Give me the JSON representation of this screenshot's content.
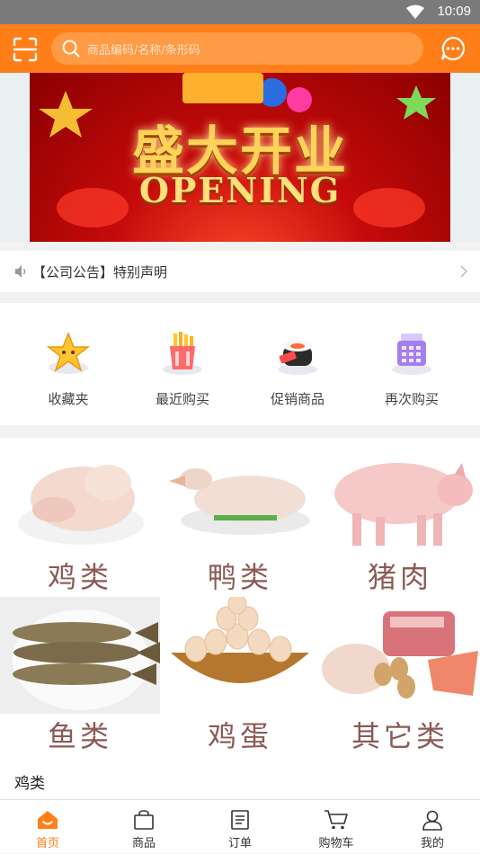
{
  "status_bar": {
    "time": "10:09"
  },
  "header": {
    "search_placeholder": "商品编码/名称/条形码"
  },
  "banner": {
    "title": "盛大开业",
    "subtitle": "OPENING"
  },
  "notice": {
    "text": "【公司公告】特别声明"
  },
  "quick_actions": [
    {
      "label": "收藏夹",
      "icon": "star-icon"
    },
    {
      "label": "最近购买",
      "icon": "fries-bag-icon"
    },
    {
      "label": "促销商品",
      "icon": "sushi-sale-icon"
    },
    {
      "label": "再次购买",
      "icon": "cash-register-icon"
    }
  ],
  "categories": [
    {
      "name": "鸡类"
    },
    {
      "name": "鸭类"
    },
    {
      "name": "猪肉"
    },
    {
      "name": "鱼类"
    },
    {
      "name": "鸡蛋"
    },
    {
      "name": "其它类"
    }
  ],
  "section": {
    "title": "鸡类"
  },
  "tabbar": [
    {
      "label": "首页",
      "active": true
    },
    {
      "label": "商品"
    },
    {
      "label": "订单"
    },
    {
      "label": "购物车"
    },
    {
      "label": "我的"
    }
  ],
  "colors": {
    "accent": "#ff7e17",
    "status_bar": "#7a7a7a",
    "category_text": "#8b5a55"
  }
}
